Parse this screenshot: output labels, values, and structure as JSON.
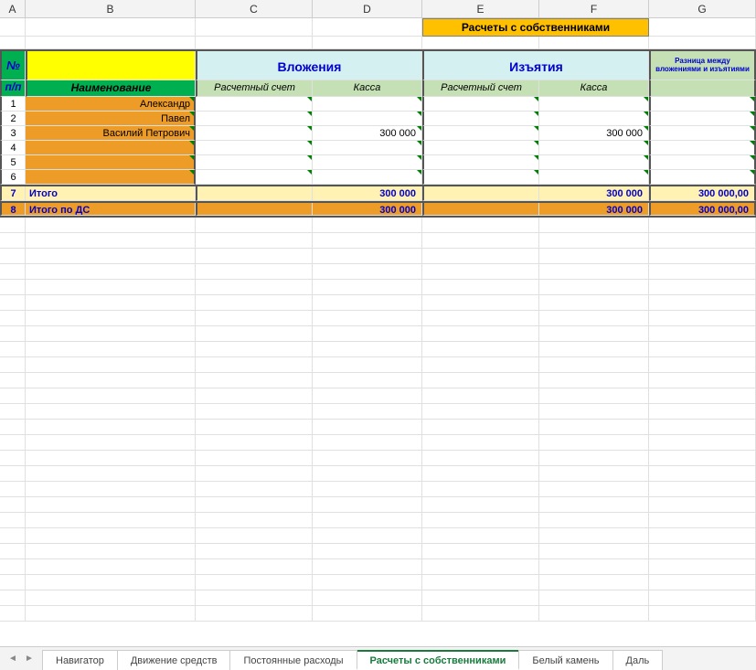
{
  "columns": [
    "A",
    "B",
    "C",
    "D",
    "E",
    "F",
    "G"
  ],
  "title": "Расчеты с собственниками",
  "headers": {
    "num": "№ п/п",
    "name": "Наименование",
    "invest": "Вложения",
    "withdraw": "Изъятия",
    "diff": "Разница между вложениями и изъятиями",
    "account": "Расчетный счет",
    "cash": "Касса"
  },
  "rows": [
    {
      "n": "1",
      "name": "Александр",
      "c": "",
      "d": "",
      "e": "",
      "f": "",
      "g": ""
    },
    {
      "n": "2",
      "name": "Павел",
      "c": "",
      "d": "",
      "e": "",
      "f": "",
      "g": ""
    },
    {
      "n": "3",
      "name": "Василий Петрович",
      "c": "",
      "d": "300 000",
      "e": "",
      "f": "300 000",
      "g": ""
    },
    {
      "n": "4",
      "name": "",
      "c": "",
      "d": "",
      "e": "",
      "f": "",
      "g": ""
    },
    {
      "n": "5",
      "name": "",
      "c": "",
      "d": "",
      "e": "",
      "f": "",
      "g": ""
    },
    {
      "n": "6",
      "name": "",
      "c": "",
      "d": "",
      "e": "",
      "f": "",
      "g": ""
    }
  ],
  "totals": {
    "n": "7",
    "label": "Итого",
    "c": "",
    "d": "300 000",
    "e": "",
    "f": "300 000",
    "g": "300 000,00"
  },
  "totals_ds": {
    "n": "8",
    "label": "Итого по ДС",
    "c": "",
    "d": "300 000",
    "e": "",
    "f": "300 000",
    "g": "300 000,00"
  },
  "tabs": [
    {
      "label": "Навигатор",
      "active": false
    },
    {
      "label": "Движение средств",
      "active": false
    },
    {
      "label": "Постоянные расходы",
      "active": false
    },
    {
      "label": "Расчеты с собственниками",
      "active": true
    },
    {
      "label": "Белый камень",
      "active": false
    },
    {
      "label": "Даль",
      "active": false
    }
  ],
  "chart_data": {
    "type": "table",
    "title": "Расчеты с собственниками",
    "columns": [
      "№ п/п",
      "Наименование",
      "Вложения / Расчетный счет",
      "Вложения / Касса",
      "Изъятия / Расчетный счет",
      "Изъятия / Касса",
      "Разница между вложениями и изъятиями"
    ],
    "rows": [
      [
        1,
        "Александр",
        null,
        null,
        null,
        null,
        null
      ],
      [
        2,
        "Павел",
        null,
        null,
        null,
        null,
        null
      ],
      [
        3,
        "Василий Петрович",
        null,
        300000,
        null,
        300000,
        null
      ],
      [
        4,
        "",
        null,
        null,
        null,
        null,
        null
      ],
      [
        5,
        "",
        null,
        null,
        null,
        null,
        null
      ],
      [
        6,
        "",
        null,
        null,
        null,
        null,
        null
      ],
      [
        7,
        "Итого",
        null,
        300000,
        null,
        300000,
        300000.0
      ],
      [
        8,
        "Итого по ДС",
        null,
        300000,
        null,
        300000,
        300000.0
      ]
    ]
  }
}
